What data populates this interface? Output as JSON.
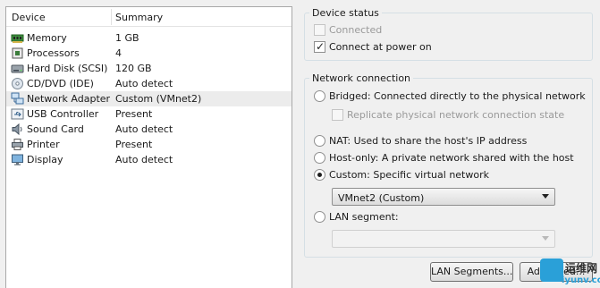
{
  "devices": {
    "header": {
      "device": "Device",
      "summary": "Summary"
    },
    "rows": [
      {
        "name": "Memory",
        "summary": "1 GB",
        "icon": "memory-icon"
      },
      {
        "name": "Processors",
        "summary": "4",
        "icon": "processor-icon"
      },
      {
        "name": "Hard Disk (SCSI)",
        "summary": "120 GB",
        "icon": "hard-disk-icon"
      },
      {
        "name": "CD/DVD (IDE)",
        "summary": "Auto detect",
        "icon": "cd-dvd-icon"
      },
      {
        "name": "Network Adapter",
        "summary": "Custom (VMnet2)",
        "icon": "network-adapter-icon",
        "selected": true
      },
      {
        "name": "USB Controller",
        "summary": "Present",
        "icon": "usb-icon"
      },
      {
        "name": "Sound Card",
        "summary": "Auto detect",
        "icon": "sound-card-icon"
      },
      {
        "name": "Printer",
        "summary": "Present",
        "icon": "printer-icon"
      },
      {
        "name": "Display",
        "summary": "Auto detect",
        "icon": "display-icon"
      }
    ]
  },
  "device_status": {
    "title": "Device status",
    "connected": {
      "label": "Connected",
      "checked": false,
      "enabled": false
    },
    "connect_at_power_on": {
      "label": "Connect at power on",
      "checked": true,
      "enabled": true
    }
  },
  "network_connection": {
    "title": "Network connection",
    "bridged": {
      "label": "Bridged: Connected directly to the physical network",
      "selected": false
    },
    "replicate": {
      "label": "Replicate physical network connection state",
      "checked": false,
      "enabled": false
    },
    "nat": {
      "label": "NAT: Used to share the host's IP address",
      "selected": false
    },
    "host_only": {
      "label": "Host-only: A private network shared with the host",
      "selected": false
    },
    "custom": {
      "label": "Custom: Specific virtual network",
      "selected": true
    },
    "vmnet_select": {
      "value": "VMnet2 (Custom)"
    },
    "lan_segment": {
      "label": "LAN segment:",
      "selected": false
    },
    "lan_segment_select": {
      "value": ""
    }
  },
  "buttons": {
    "lan_segments": "LAN Segments...",
    "advanced": "Advanced..."
  },
  "watermark": {
    "line1": "运维网",
    "line2": "iyunv.com"
  },
  "colors": {
    "selected_row": "#ececec",
    "watermark_blue": "#2aa0d8"
  }
}
